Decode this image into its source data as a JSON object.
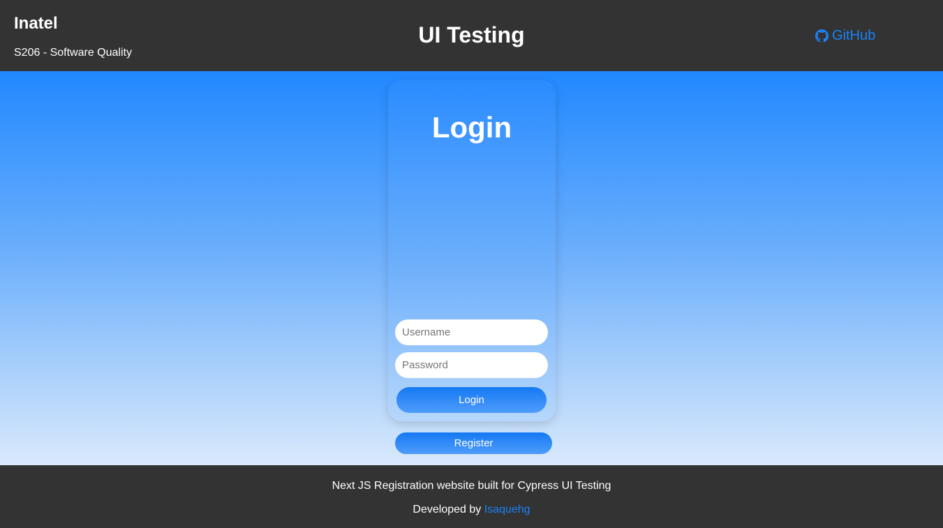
{
  "header": {
    "brand_title": "Inatel",
    "brand_subtitle": "S206 - Software Quality",
    "page_heading": "UI Testing",
    "github_label": "GitHub",
    "github_icon": "github-icon"
  },
  "login_card": {
    "title": "Login",
    "username_placeholder": "Username",
    "username_value": "",
    "password_placeholder": "Password",
    "password_value": "",
    "login_button_label": "Login"
  },
  "register_button_label": "Register",
  "footer": {
    "line1": "Next JS Registration website built for Cypress UI Testing",
    "developed_by": "Developed by ",
    "author_link": "Isaquehg"
  },
  "colors": {
    "header_bg": "#333333",
    "accent": "#1a82f7",
    "gradient_top": "#2188ff",
    "gradient_bottom": "#d9e9fc"
  }
}
